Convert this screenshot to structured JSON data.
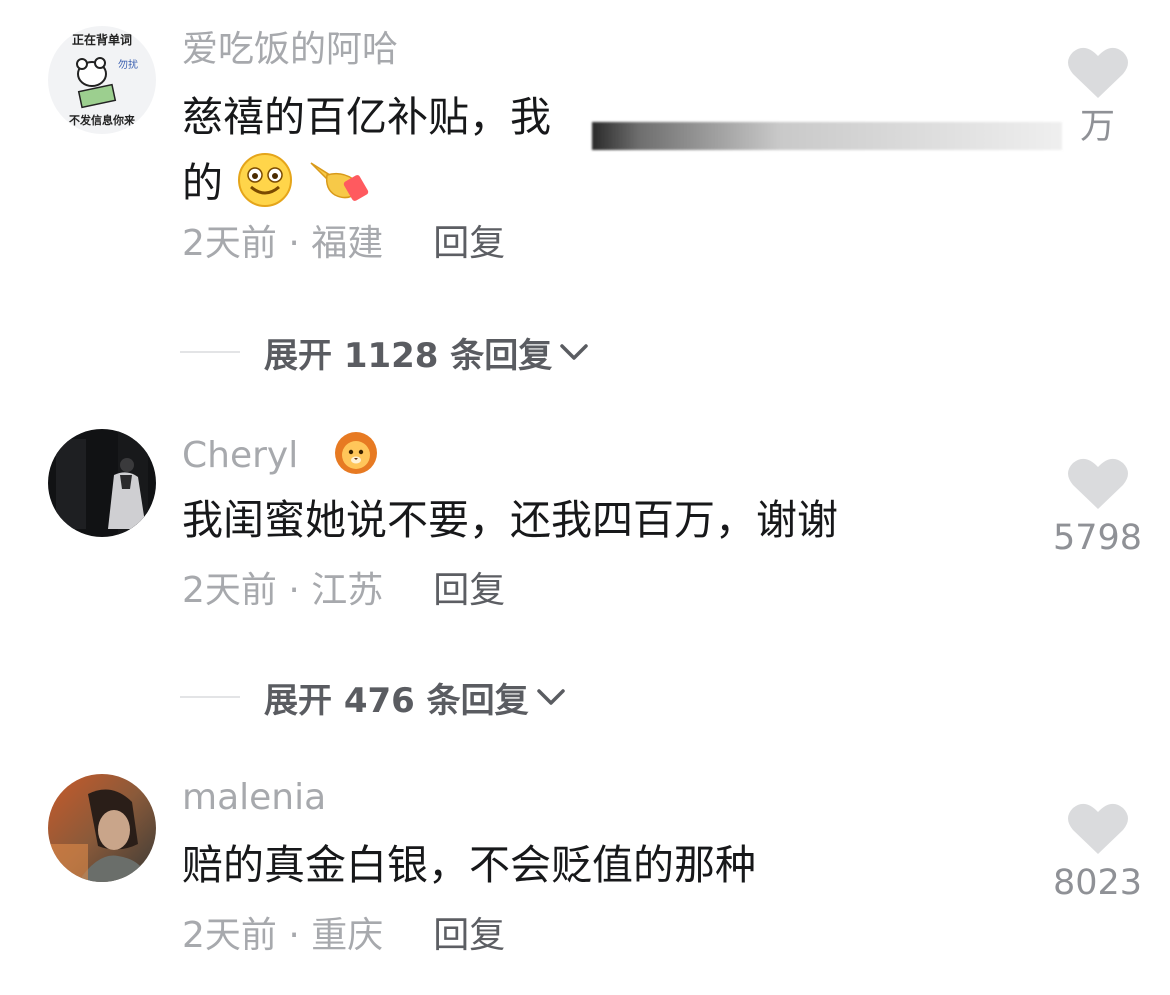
{
  "comments": [
    {
      "username": "爱吃饭的阿哈",
      "avatar_icon": "mouse-reading-sticker-avatar",
      "avatar_text": [
        "正在背单词",
        "勿扰",
        "不发信息你来"
      ],
      "text_line1": "慈禧的百亿补贴，我",
      "text_line2": "的",
      "emojis": [
        "smile-face-icon",
        "pointing-hand-icon"
      ],
      "time": "2天前",
      "location": "福建",
      "meta_sep": " · ",
      "reply_label": "回复",
      "like_count": "",
      "like_suffix": "万",
      "expand_label": "展开 1128 条回复"
    },
    {
      "username": "Cheryl",
      "badge_icon": "lion-emoji-icon",
      "avatar_icon": "dark-photo-avatar",
      "text": "我闺蜜她说不要，还我四百万，谢谢",
      "time": "2天前",
      "location": "江苏",
      "meta_sep": " · ",
      "reply_label": "回复",
      "like_count": "5798",
      "expand_label": "展开 476 条回复"
    },
    {
      "username": "malenia",
      "avatar_icon": "portrait-photo-avatar",
      "text": "赔的真金白银，不会贬值的那种",
      "time": "2天前",
      "location": "重庆",
      "meta_sep": " · ",
      "reply_label": "回复",
      "like_count": "8023"
    }
  ],
  "colors": {
    "username": "#a7a9ad",
    "body": "#17181a",
    "reply": "#5c5e63",
    "heart": "#dadbdd",
    "like_count": "#8f9196"
  }
}
